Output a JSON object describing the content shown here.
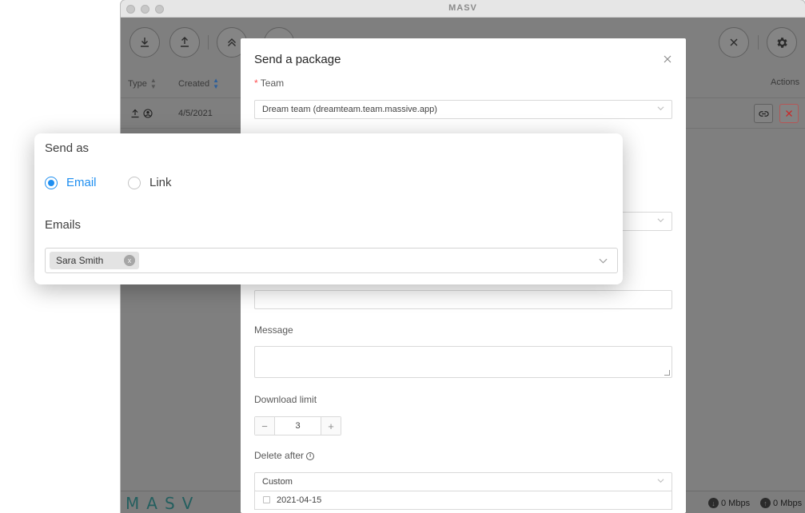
{
  "window": {
    "title": "MASV"
  },
  "toolbar": {
    "download_icon": "download-icon",
    "upload_icon": "upload-icon",
    "collapse_icon": "double-chevron-up-icon",
    "close_icon": "close-icon",
    "settings_icon": "gear-icon"
  },
  "table": {
    "columns": {
      "type": "Type",
      "created": "Created",
      "actions": "Actions"
    },
    "rows": [
      {
        "created": "4/5/2021"
      }
    ]
  },
  "modal": {
    "title": "Send a package",
    "team_label": "Team",
    "team_value": "Dream team (dreamteam.team.massive.app)",
    "message_label": "Message",
    "download_limit_label": "Download limit",
    "download_limit_value": "3",
    "delete_after_label": "Delete after",
    "delete_after_value": "Custom",
    "delete_date": "2021-04-15",
    "minus": "−",
    "plus": "+"
  },
  "send_as": {
    "label": "Send as",
    "options": [
      {
        "label": "Email",
        "checked": true
      },
      {
        "label": "Link",
        "checked": false
      }
    ],
    "emails_label": "Emails",
    "recipients": [
      {
        "name": "Sara Smith",
        "remove": "x"
      }
    ]
  },
  "status_bar": {
    "logo": "MASV",
    "download_speed": "0 Mbps",
    "upload_speed": "0 Mbps"
  },
  "colors": {
    "accent": "#1e8ef0",
    "danger": "#ff4d4f",
    "logo": "#245f5f"
  }
}
